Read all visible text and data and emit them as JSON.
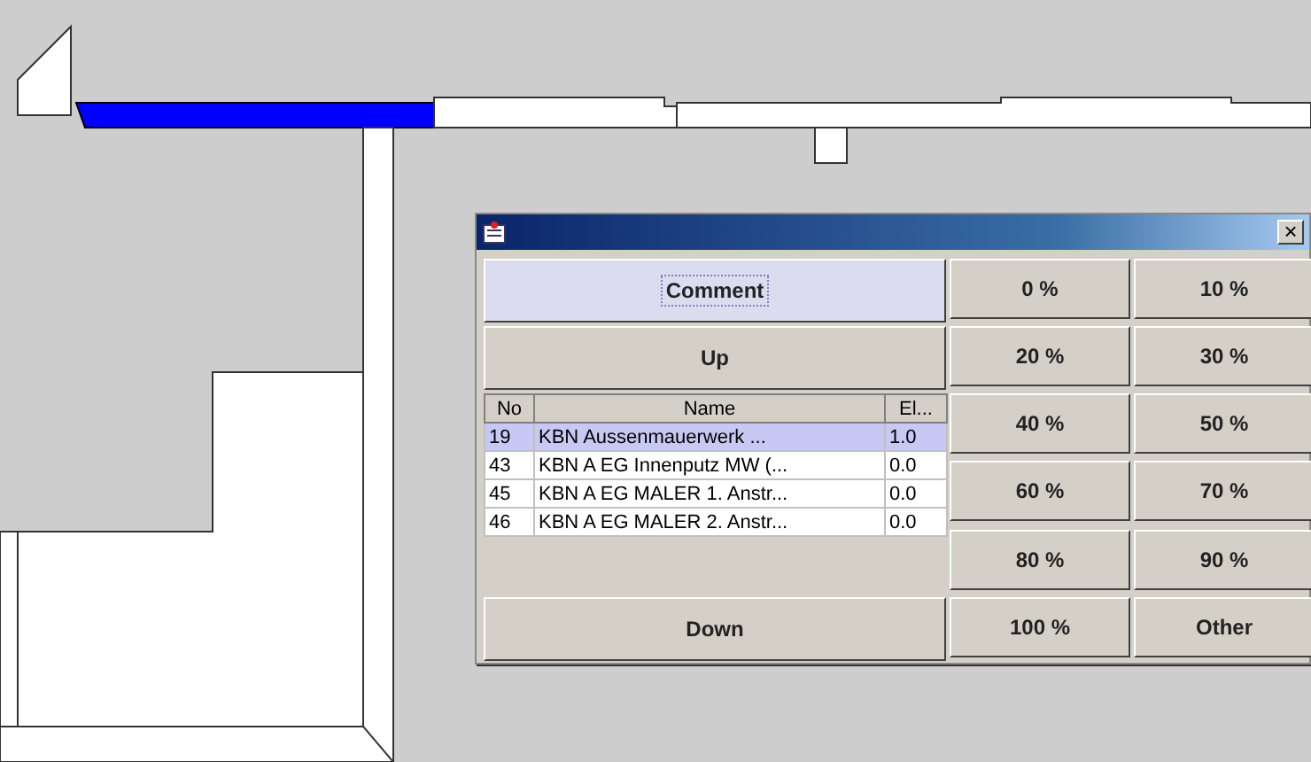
{
  "drawing": {
    "selected_wall": true
  },
  "dialog": {
    "close": "×",
    "left_buttons": [
      {
        "label": "Comment",
        "focused": true
      },
      {
        "label": "Up",
        "focused": false
      }
    ],
    "table": {
      "columns": [
        "No",
        "Name",
        "El..."
      ],
      "rows": [
        {
          "cells": [
            "19",
            "KBN Aussenmauerwerk ...",
            "1.0"
          ],
          "selected": true
        },
        {
          "cells": [
            "43",
            "KBN A EG Innenputz MW (...",
            "0.0"
          ],
          "selected": false
        },
        {
          "cells": [
            "45",
            "KBN A EG MALER 1. Anstr...",
            "0.0"
          ],
          "selected": false
        },
        {
          "cells": [
            "46",
            "KBN A EG MALER 2. Anstr...",
            "0.0"
          ],
          "selected": false
        }
      ]
    },
    "bottom_button": "Down",
    "percent_buttons": [
      "0 %",
      "10 %",
      "20 %",
      "30 %",
      "40 %",
      "50 %",
      "60 %",
      "70 %",
      "80 %",
      "90 %",
      "100 %",
      "Other"
    ]
  }
}
